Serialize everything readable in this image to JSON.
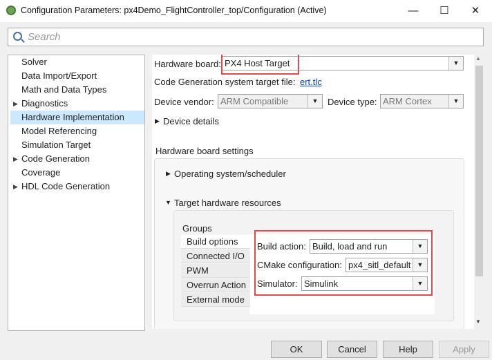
{
  "window": {
    "title": "Configuration Parameters: px4Demo_FlightController_top/Configuration (Active)",
    "minimize": "—",
    "maximize": "☐",
    "close": "✕"
  },
  "search": {
    "placeholder": "Search"
  },
  "tree": [
    {
      "label": "Solver",
      "expandable": false
    },
    {
      "label": "Data Import/Export",
      "expandable": false
    },
    {
      "label": "Math and Data Types",
      "expandable": false
    },
    {
      "label": "Diagnostics",
      "expandable": true
    },
    {
      "label": "Hardware Implementation",
      "expandable": false,
      "selected": true
    },
    {
      "label": "Model Referencing",
      "expandable": false
    },
    {
      "label": "Simulation Target",
      "expandable": false
    },
    {
      "label": "Code Generation",
      "expandable": true
    },
    {
      "label": "Coverage",
      "expandable": false
    },
    {
      "label": "HDL Code Generation",
      "expandable": true
    }
  ],
  "main": {
    "hardware_board_label": "Hardware board:",
    "hardware_board_value": "PX4 Host Target",
    "target_file_label": "Code Generation system target file:",
    "target_file_link": "ert.tlc",
    "device_vendor_label": "Device vendor:",
    "device_vendor_value": "ARM Compatible",
    "device_type_label": "Device type:",
    "device_type_value": "ARM Cortex",
    "device_details": "Device details",
    "hw_settings": "Hardware board settings",
    "os_scheduler": "Operating system/scheduler",
    "target_resources": "Target hardware resources",
    "groups_label": "Groups",
    "groups": [
      "Build options",
      "Connected I/O",
      "PWM",
      "Overrun Action",
      "External mode"
    ],
    "build_action_label": "Build action:",
    "build_action_value": "Build, load and run",
    "cmake_label": "CMake configuration:",
    "cmake_value": "px4_sitl_default",
    "simulator_label": "Simulator:",
    "simulator_value": "Simulink"
  },
  "buttons": {
    "ok": "OK",
    "cancel": "Cancel",
    "help": "Help",
    "apply": "Apply"
  },
  "colors": {
    "highlight": "#e8474a",
    "selection": "#cce8ff",
    "link": "#0645ad"
  }
}
